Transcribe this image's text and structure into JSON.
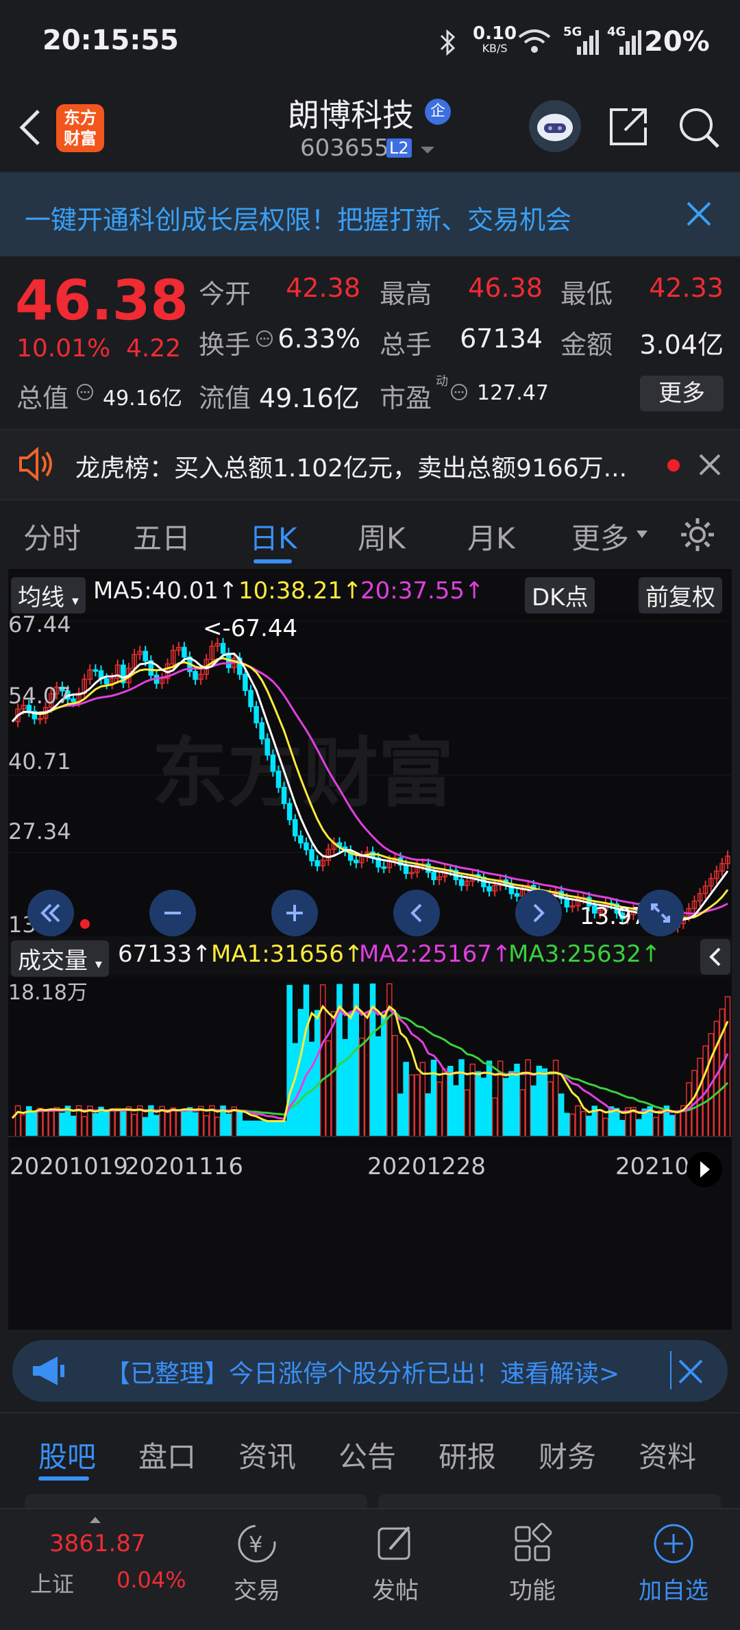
{
  "status": {
    "time": "20:15:55",
    "net_speed_top": "0.10",
    "net_speed_unit": "KB/S",
    "sig1": "5G",
    "sig2": "4G",
    "battery": "20%"
  },
  "header": {
    "logo_line1": "东方",
    "logo_line2": "财富",
    "title": "朗博科技",
    "badge": "企",
    "code": "603655",
    "level": "L2"
  },
  "banner": {
    "text": "一键开通科创成长层权限！把握打新、交易机会"
  },
  "quote": {
    "price": "46.38",
    "change_pct": "10.01%",
    "change": "4.22",
    "open_label": "今开",
    "open": "42.38",
    "high_label": "最高",
    "high": "46.38",
    "low_label": "最低",
    "low": "42.33",
    "turnover_label": "换手",
    "turnover": "6.33%",
    "volume_label": "总手",
    "volume": "67134",
    "amount_label": "金额",
    "amount": "3.04亿",
    "mcap_label": "总值",
    "mcap": "49.16亿",
    "float_label": "流值",
    "float": "49.16亿",
    "pe_label": "市盈",
    "pe_sup": "动",
    "pe": "127.47",
    "more": "更多"
  },
  "notice": {
    "text": "龙虎榜：买入总额1.102亿元，卖出总额9166万..."
  },
  "tabs": [
    "分时",
    "五日",
    "日K",
    "周K",
    "月K",
    "更多"
  ],
  "active_tab": "日K",
  "kchart": {
    "ma_select": "均线",
    "ma5": "MA5:40.01↑",
    "ma10": "10:38.21↑",
    "ma20": "20:37.55↑",
    "dk": "DK点",
    "adjust": "前复权",
    "y_labels": [
      "67.44",
      "54.07",
      "40.71",
      "27.34",
      "13.97"
    ],
    "max_mark": "<-67.44",
    "min_mark": "13.97->",
    "watermark": "东方财富",
    "colors": {
      "ma5": "#ffffff",
      "ma10": "#ffeb3b",
      "ma20": "#e040e0",
      "up": "#e03030",
      "down": "#00e5ff"
    }
  },
  "volume": {
    "select": "成交量",
    "value": "67133↑",
    "ma1": "MA1:31656↑",
    "ma2": "MA2:25167↑",
    "ma3": "MA3:25632↑",
    "ymax": "18.18万",
    "dates": [
      "20201019",
      "20201116",
      "20201228",
      "20210"
    ]
  },
  "ad": {
    "text": "【已整理】今日涨停个股分析已出！速看解读>"
  },
  "tabs2": [
    "股吧",
    "盘口",
    "资讯",
    "公告",
    "研报",
    "财务",
    "资料"
  ],
  "active_tab2": "股吧",
  "footer": {
    "index_value": "3861.87",
    "index_name": "上证",
    "index_change": "0.04%",
    "items": [
      "交易",
      "发帖",
      "功能",
      "加自选"
    ]
  },
  "chart_data": {
    "type": "candlestick",
    "title": "",
    "ylim": [
      13.97,
      67.44
    ],
    "x_labels": [
      "20201019",
      "20201116",
      "20201228",
      "20210"
    ],
    "series": [
      {
        "name": "MA5",
        "values": [
          40.01
        ]
      },
      {
        "name": "10",
        "values": [
          38.21
        ]
      },
      {
        "name": "20",
        "values": [
          37.55
        ]
      }
    ],
    "high": 67.44,
    "low": 13.97
  }
}
